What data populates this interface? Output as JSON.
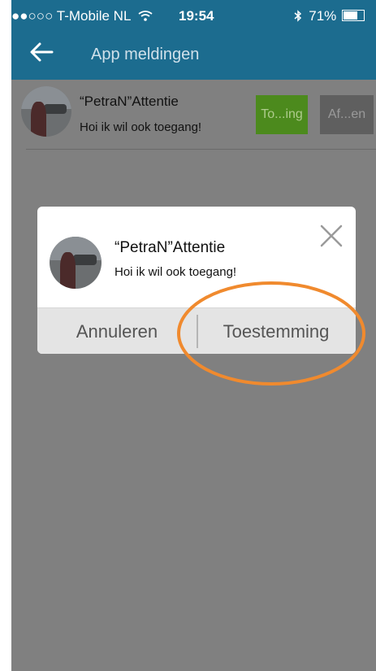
{
  "status_bar": {
    "carrier": "●●○○○ T-Mobile NL",
    "time": "19:54",
    "battery": "71%"
  },
  "nav": {
    "title": "App meldingen"
  },
  "notification": {
    "name": "“PetraN”Attentie",
    "message": "Hoi ik wil ook toegang!",
    "allow_label": "To...ing",
    "deny_label": "Af...en"
  },
  "dialog": {
    "name": "“PetraN”Attentie",
    "message": "Hoi ik wil ook toegang!",
    "cancel_label": "Annuleren",
    "confirm_label": "Toestemming"
  },
  "colors": {
    "header": "#1c6c8f",
    "allow_button": "#4c8a1d",
    "deny_button": "#5f5f5f",
    "highlight": "#f08a2e",
    "overlay": "#808080"
  },
  "icons": {
    "back": "arrow-left-icon",
    "close": "close-icon",
    "wifi": "wifi-icon",
    "bluetooth": "bluetooth-icon",
    "battery": "battery-icon"
  }
}
